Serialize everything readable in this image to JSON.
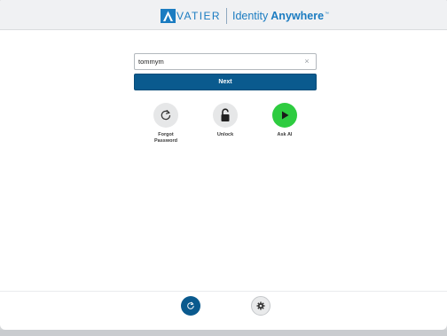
{
  "brand": {
    "logo_letter": "A",
    "name": "VATIER",
    "tagline_light": "Identity",
    "tagline_bold": "Anywhere",
    "trademark": "™",
    "color": "#1b7cc1"
  },
  "login": {
    "username_value": "tommym",
    "clear_icon": "×",
    "next_label": "Next"
  },
  "actions": [
    {
      "label": "Forgot Password",
      "icon": "refresh-icon"
    },
    {
      "label": "Unlock",
      "icon": "unlocked-padlock-icon"
    },
    {
      "label": "Ask AI",
      "icon": "play-icon",
      "color": "#2ecc40"
    }
  ],
  "footer": {
    "left_icon": "refresh-icon",
    "right_icon": "gear-icon",
    "accent": "#0a5a8e"
  }
}
